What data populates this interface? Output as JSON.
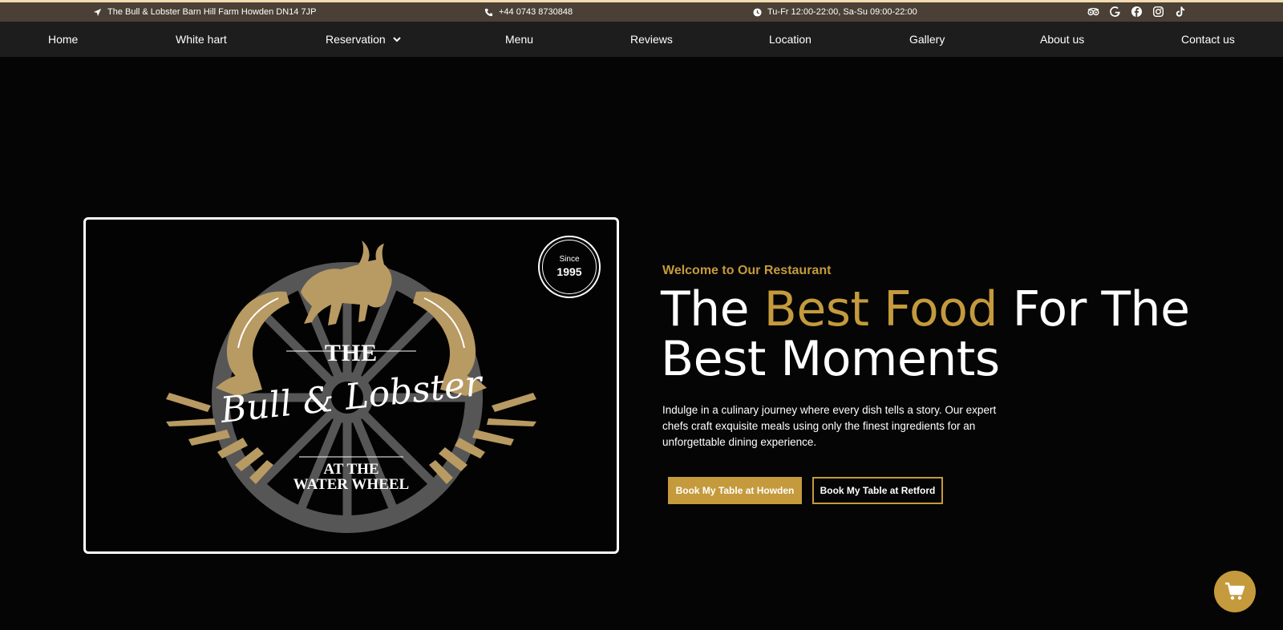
{
  "topbar": {
    "address": "The Bull & Lobster Barn Hill Farm Howden DN14 7JP",
    "phone": "+44 0743 8730848",
    "hours": "Tu-Fr 12:00-22:00, Sa-Su 09:00-22:00",
    "social_icons": [
      "tripadvisor-icon",
      "google-icon",
      "facebook-icon",
      "instagram-icon",
      "tiktok-icon"
    ]
  },
  "nav": {
    "items": [
      {
        "label": "Home"
      },
      {
        "label": "White hart"
      },
      {
        "label": "Reservation",
        "dropdown": true
      },
      {
        "label": "Menu"
      },
      {
        "label": "Reviews"
      },
      {
        "label": "Location"
      },
      {
        "label": "Gallery"
      },
      {
        "label": "About us"
      },
      {
        "label": "Contact us"
      }
    ]
  },
  "logo": {
    "since_label": "Since",
    "since_year": "1995",
    "line1": "THE",
    "line2": "Bull & Lobster",
    "line3": "AT THE",
    "line4": "WATER WHEEL"
  },
  "hero": {
    "welcome": "Welcome to Our Restaurant",
    "headline_pre": "The ",
    "headline_gold": "Best Food",
    "headline_post": " For The Best Moments",
    "intro": "Indulge in a culinary journey where every dish tells a story. Our expert chefs craft exquisite meals using only the finest ingredients for an unforgettable dining experience.",
    "btn_howden": "Book My Table at Howden",
    "btn_retford": "Book My Table at Retford"
  },
  "colors": {
    "accent_gold": "#c49a3c",
    "topbar_bg": "#4a4035",
    "nav_bg": "#1d1d1d",
    "page_bg": "#050505"
  }
}
